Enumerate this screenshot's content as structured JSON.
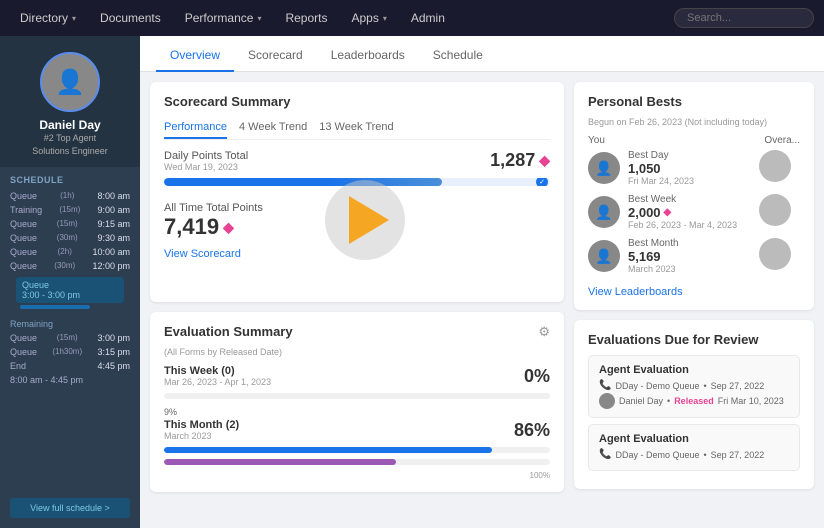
{
  "nav": {
    "items": [
      {
        "label": "Directory",
        "has_dropdown": true
      },
      {
        "label": "Documents",
        "has_dropdown": false
      },
      {
        "label": "Performance",
        "has_dropdown": true
      },
      {
        "label": "Reports",
        "has_dropdown": false
      },
      {
        "label": "Apps",
        "has_dropdown": true
      },
      {
        "label": "Admin",
        "has_dropdown": false
      }
    ],
    "search_placeholder": "Search..."
  },
  "sidebar": {
    "agent_name": "Daniel Day",
    "agent_badge1": "#2 Top Agent",
    "agent_badge2": "Solutions Engineer",
    "section_label": "Schedule",
    "schedule_items": [
      {
        "label": "Queue",
        "detail": "(1h)",
        "time": "8:00 am"
      },
      {
        "label": "Training",
        "detail": "(15m)",
        "time": "9:00 am"
      },
      {
        "label": "Queue",
        "detail": "(15m)",
        "time": "9:15 am"
      },
      {
        "label": "Queue",
        "detail": "(30m)",
        "time": "9:30 am"
      },
      {
        "label": "Queue",
        "detail": "(2h)",
        "time": "10:00 am"
      },
      {
        "label": "Queue",
        "detail": "(30m)",
        "time": "12:00 pm"
      }
    ],
    "current_block_label": "Queue",
    "current_block_time": "3:00 - 3:00 pm",
    "remaining_label": "Remaining",
    "remaining_items": [
      {
        "label": "Queue",
        "detail": "(15m)",
        "time": "3:00 pm"
      },
      {
        "label": "Queue",
        "detail": "(1h30m)",
        "time": "3:15 pm"
      },
      {
        "label": "End",
        "detail": "",
        "time": "4:45 pm"
      },
      {
        "label": "Queue",
        "detail": "",
        "time": ""
      },
      {
        "label": "8:00 am - 4:45 pm",
        "detail": "",
        "time": ""
      }
    ],
    "full_schedule_btn": "View full schedule >"
  },
  "tabs": [
    {
      "label": "Overview",
      "active": true
    },
    {
      "label": "Scorecard",
      "active": false
    },
    {
      "label": "Leaderboards",
      "active": false
    },
    {
      "label": "Schedule",
      "active": false
    }
  ],
  "scorecard_summary": {
    "title": "Scorecard Summary",
    "sub_tabs": [
      {
        "label": "Performance",
        "active": true
      },
      {
        "label": "4 Week Trend",
        "active": false
      },
      {
        "label": "13 Week Trend",
        "active": false
      }
    ],
    "daily_points_label": "Daily Points Total",
    "daily_points_date": "Wed Mar 19, 2023",
    "daily_points_value": "1,287",
    "progress_bar_pct": 72,
    "all_time_label": "All Time Total Points",
    "all_time_value": "7,419",
    "view_scorecard": "View Scorecard"
  },
  "personal_bests": {
    "title": "Personal Bests",
    "subtitle": "Begun on Feb 26, 2023 (Not including today)",
    "you_label": "You",
    "overall_label": "Overa...",
    "items": [
      {
        "type": "Best Day",
        "value": "1,050",
        "date": "Fri Mar 24, 2023",
        "has_diamond": false
      },
      {
        "type": "Best Week",
        "value": "2,000",
        "date": "Feb 26, 2023 - Mar 4, 2023",
        "has_diamond": true
      },
      {
        "type": "Best Month",
        "value": "5,169",
        "date": "March 2023",
        "has_diamond": false
      }
    ],
    "view_leaderboards": "View Leaderboards"
  },
  "evaluation_summary": {
    "title": "Evaluation Summary",
    "subtitle": "(All Forms by Released Date)",
    "this_week_label": "This Week (0)",
    "this_week_date": "Mar 26, 2023 - Apr 1, 2023",
    "this_week_pct": "0%",
    "this_week_bar_pct": 0,
    "this_month_pct_label": "9%",
    "this_month_label": "This Month (2)",
    "this_month_date": "March 2023",
    "this_month_pct": "86%",
    "bar1_color": "#2ecc71",
    "bar1_pct": 85,
    "bar2_color": "#9b59b6",
    "bar2_pct": 60,
    "bar_100_label": "100%"
  },
  "evaluations_due": {
    "title": "Evaluations Due for Review",
    "items": [
      {
        "title": "Agent Evaluation",
        "queue": "DDay - Demo Queue",
        "queue_date": "Sep 27, 2022",
        "agent_name": "Daniel Day",
        "released_label": "Released",
        "released_date": "Fri Mar 10, 2023"
      },
      {
        "title": "Agent Evaluation",
        "queue": "DDay - Demo Queue",
        "queue_date": "Sep 27, 2022",
        "agent_name": "",
        "released_label": "",
        "released_date": ""
      }
    ]
  }
}
